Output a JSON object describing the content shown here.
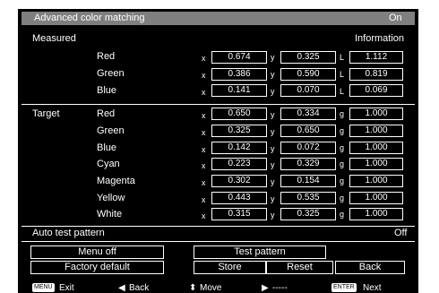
{
  "header": {
    "title": "Advanced color matching",
    "value": "On"
  },
  "measured": {
    "label": "Measured",
    "info": "Information",
    "rows": [
      {
        "name": "Red",
        "x": "0.674",
        "y": "0.325",
        "L": "1.112"
      },
      {
        "name": "Green",
        "x": "0.386",
        "y": "0.590",
        "L": "0.819"
      },
      {
        "name": "Blue",
        "x": "0.141",
        "y": "0.070",
        "L": "0.069"
      }
    ]
  },
  "target": {
    "label": "Target",
    "rows": [
      {
        "name": "Red",
        "x": "0.650",
        "y": "0.334",
        "g": "1.000"
      },
      {
        "name": "Green",
        "x": "0.325",
        "y": "0.650",
        "g": "1.000"
      },
      {
        "name": "Blue",
        "x": "0.142",
        "y": "0.072",
        "g": "1.000"
      },
      {
        "name": "Cyan",
        "x": "0.223",
        "y": "0.329",
        "g": "1.000"
      },
      {
        "name": "Magenta",
        "x": "0.302",
        "y": "0.154",
        "g": "1.000"
      },
      {
        "name": "Yellow",
        "x": "0.443",
        "y": "0.535",
        "g": "1.000"
      },
      {
        "name": "White",
        "x": "0.315",
        "y": "0.325",
        "g": "1.000"
      }
    ]
  },
  "labels": {
    "x": "x",
    "y": "y",
    "L": "L",
    "g": "g"
  },
  "auto_test": {
    "label": "Auto test pattern",
    "value": "Off"
  },
  "buttons": {
    "menu_off": "Menu off",
    "test_pattern": "Test pattern",
    "factory_default": "Factory default",
    "store": "Store",
    "reset": "Reset",
    "back": "Back"
  },
  "footer": {
    "menu_key": "MENU",
    "exit": "Exit",
    "back": "Back",
    "move": "Move",
    "right": "-----",
    "enter_key": "ENTER",
    "next": "Next"
  }
}
